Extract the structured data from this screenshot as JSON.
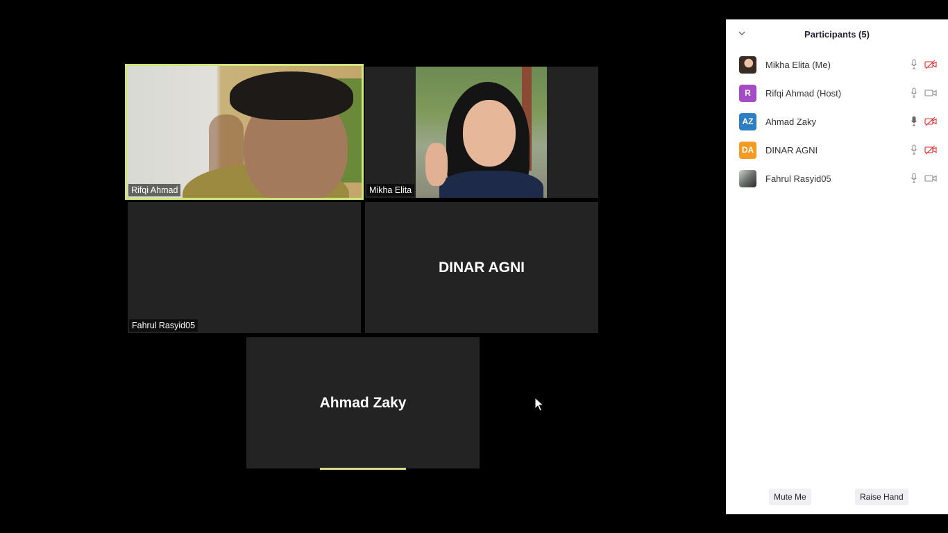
{
  "gallery": {
    "tiles": [
      {
        "name": "Rifqi Ahmad"
      },
      {
        "name": "Mikha Elita"
      },
      {
        "name": "Fahrul Rasyid05"
      },
      {
        "name": "DINAR AGNI"
      },
      {
        "name": "Ahmad Zaky"
      }
    ],
    "active_speaker_color": "#cde57a"
  },
  "participants_panel": {
    "title": "Participants (5)",
    "participants": [
      {
        "name": "Mikha Elita (Me)",
        "avatar": "photo",
        "mic": "unmuted",
        "video": "off"
      },
      {
        "name": "Rifqi Ahmad (Host)",
        "avatar_initials": "R",
        "avatar_color": "#a54bc7",
        "mic": "unmuted",
        "video": "on"
      },
      {
        "name": "Ahmad Zaky",
        "avatar_initials": "AZ",
        "avatar_color": "#2d7ec2",
        "mic": "muted",
        "video": "off"
      },
      {
        "name": "DINAR AGNI",
        "avatar_initials": "DA",
        "avatar_color": "#f39b22",
        "mic": "unmuted",
        "video": "off"
      },
      {
        "name": "Fahrul Rasyid05",
        "avatar": "photo",
        "mic": "unmuted",
        "video": "on"
      }
    ],
    "buttons": {
      "mute_me": "Mute Me",
      "raise_hand": "Raise Hand"
    }
  }
}
